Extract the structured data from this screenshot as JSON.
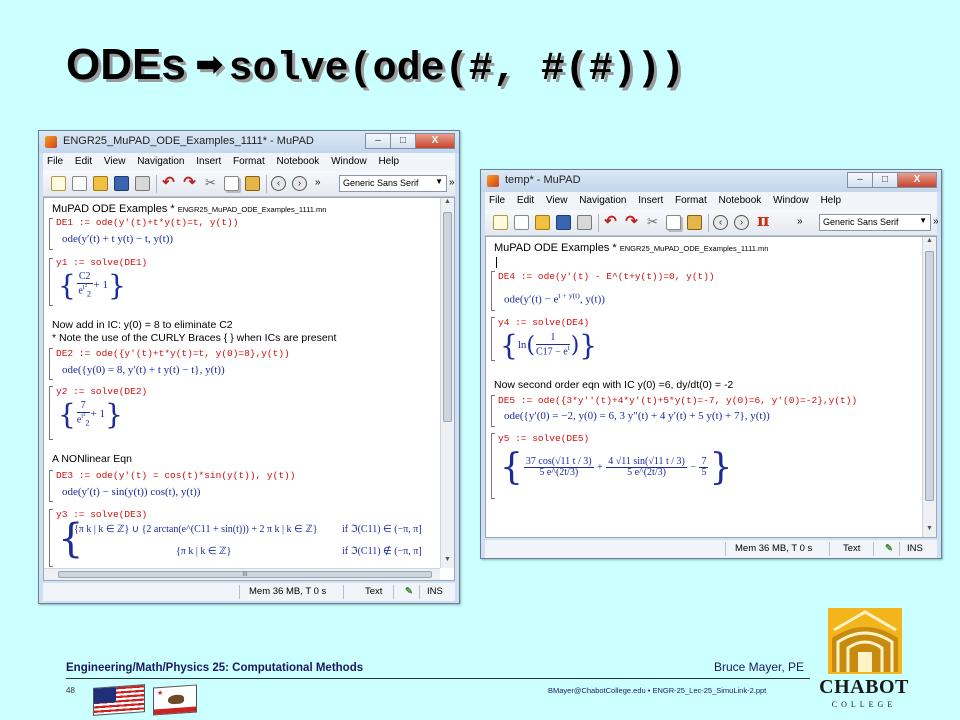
{
  "slide": {
    "title_prefix": "ODEs",
    "title_arrow": "➡",
    "title_code": "solve(ode(#, #(#)))",
    "footer_left": "Engineering/Math/Physics 25: Computational Methods",
    "footer_author": "Bruce Mayer, PE",
    "page_number": "48",
    "footer_file": "BMayer@ChabotCollege.edu  •  ENGR-25_Lec-25_SimuLink-2.ppt",
    "logo_text": "CHABOT",
    "logo_sub": "COLLEGE"
  },
  "window_left": {
    "title": "ENGR25_MuPAD_ODE_Examples_1111* - MuPAD",
    "buttons": {
      "minimize": "–",
      "maximize": "□",
      "close": "X"
    },
    "menu": [
      "File",
      "Edit",
      "View",
      "Navigation",
      "Insert",
      "Format",
      "Notebook",
      "Window",
      "Help"
    ],
    "font_select": "Generic Sans Serif",
    "doc_title": "MuPAD ODE Examples *",
    "doc_file": "ENGR25_MuPAD_ODE_Examples_1111.mn",
    "cmd_de1": "DE1 := ode(y'(t)+t*y(t)=t, y(t))",
    "out_de1": "ode(y′(t) + t y(t) − t, y(t))",
    "cmd_y1": "y1 := solve(DE1)",
    "out_y1_c": "C2",
    "out_y1_t2": "t²",
    "out_y1_2": "2",
    "out_y1_e": "e",
    "out_y1_plus": "+ 1",
    "note_ic_1": "Now add in IC: y(0) = 8 to eliminate C2",
    "note_ic_2": "* Note the use of the CURLY Braces { } when ICs are present",
    "cmd_de2": "DE2 := ode({y'(t)+t*y(t)=t, y(0)=8},y(t))",
    "out_de2": "ode({y(0) = 8, y′(t) + t y(t) − t}, y(t))",
    "cmd_y2": "y2 := solve(DE2)",
    "out_y2_num": "7",
    "out_y2_plus": "+ 1",
    "note_nonlinear": "A NONlinear Eqn",
    "cmd_de3": "DE3 := ode(y'(t) = cos(t)*sin(y(t)), y(t))",
    "out_de3": "ode(y′(t) − sin(y(t)) cos(t), y(t))",
    "cmd_y3": "y3 := solve(DE3)",
    "out_y3_row1": "{π k | k ∈ ℤ} ∪ {2 arctan(e^(C11 + sin(t))) + 2 π k | k ∈ ℤ}",
    "out_y3_cond1": "if ℑ(C11) ∈ (−π, π]",
    "out_y3_row2": "{π k | k ∈ ℤ}",
    "out_y3_cond2": "if ℑ(C11) ∉ (−π, π]",
    "status_mem": "Mem 36 MB, T 0 s",
    "status_mode": "Text",
    "status_ins": "INS"
  },
  "window_right": {
    "title": "temp* - MuPAD",
    "buttons": {
      "minimize": "–",
      "maximize": "□",
      "close": "X"
    },
    "menu": [
      "File",
      "Edit",
      "View",
      "Navigation",
      "Insert",
      "Format",
      "Notebook",
      "Window",
      "Help"
    ],
    "font_select": "Generic Sans Serif",
    "doc_title": "MuPAD ODE Examples *",
    "doc_file": "ENGR25_MuPAD_ODE_Examples_1111.mn",
    "cmd_de4": "DE4 := ode(y'(t) - E^(t+y(t))=0, y(t))",
    "out_de4_a": "ode(y′(t) − e",
    "out_de4_exp": "t + y(t)",
    "out_de4_b": ", y(t))",
    "cmd_y4": "y4 := solve(DE4)",
    "out_y4_ln": "ln",
    "out_y4_num": "1",
    "out_y4_den": "C17 − e",
    "out_y4_exp": "t",
    "note_second": "Now second order eqn with IC y(0) =6, dy/dt(0) = -2",
    "cmd_de5": "DE5 := ode({3*y''(t)+4*y'(t)+5*y(t)=-7, y(0)=6, y'(0)=-2},y(t))",
    "out_de5": "ode({y′(0) = −2, y(0) = 6, 3 y″(t) + 4 y′(t) + 5 y(t) + 7}, y(t))",
    "cmd_y5": "y5 := solve(DE5)",
    "out_y5_n1": "37 cos(√11 t / 3)",
    "out_y5_d1": "5 e^(2t/3)",
    "out_y5_n2": "4 √11 sin(√11 t / 3)",
    "out_y5_d2": "5 e^(2t/3)",
    "out_y5_n3": "7",
    "out_y5_d3": "5",
    "status_mem": "Mem 36 MB, T 0 s",
    "status_mode": "Text",
    "status_ins": "INS"
  }
}
